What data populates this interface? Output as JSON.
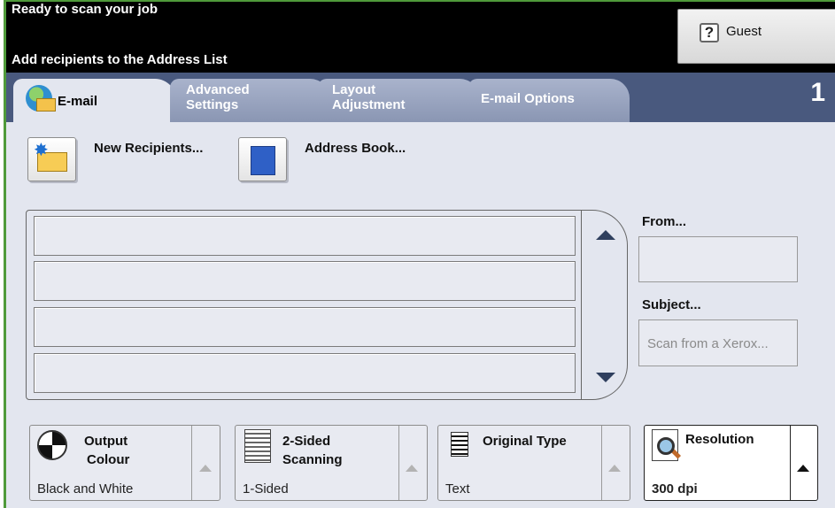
{
  "status": {
    "line1": "Ready to scan your job",
    "line2": "Add recipients to the Address List"
  },
  "user": {
    "label": "Guest",
    "icon": "question-mark-icon"
  },
  "tabs": [
    {
      "label": "E-mail",
      "active": true,
      "icon": "globe-envelope-icon"
    },
    {
      "label_line1": "Advanced",
      "label_line2": "Settings"
    },
    {
      "label_line1": "Layout",
      "label_line2": "Adjustment"
    },
    {
      "label": "E-mail Options"
    }
  ],
  "tab_count": "1",
  "recipients": {
    "new_label": "New Recipients...",
    "address_book_label": "Address Book...",
    "rows": [
      "",
      "",
      "",
      ""
    ]
  },
  "from": {
    "label": "From...",
    "value": ""
  },
  "subject": {
    "label": "Subject...",
    "value": "Scan from a Xerox..."
  },
  "features": {
    "output_colour": {
      "title_line1": "Output",
      "title_line2": "Colour",
      "value": "Black and White"
    },
    "two_sided": {
      "title_line1": "2-Sided",
      "title_line2": "Scanning",
      "value": "1-Sided"
    },
    "original_type": {
      "title": "Original Type",
      "value": "Text"
    },
    "resolution": {
      "title": "Resolution",
      "value": "300 dpi"
    }
  },
  "colors": {
    "status_bg": "#000000",
    "tabbar_bg": "#49597e",
    "panel_bg": "#e3e6ef",
    "frame_green": "#4f9a3a"
  }
}
